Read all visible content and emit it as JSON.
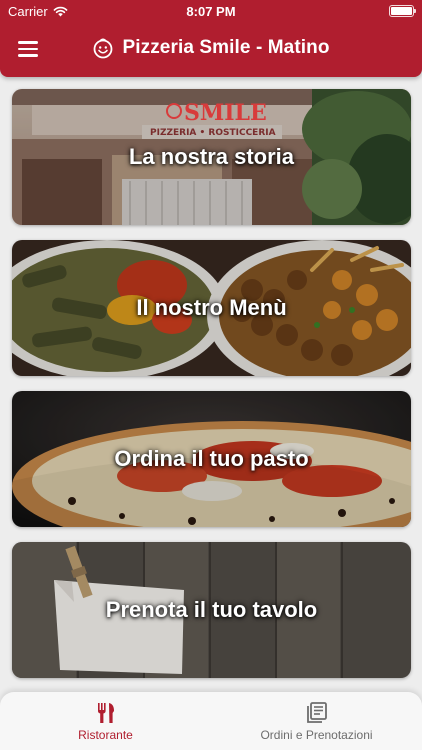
{
  "status_bar": {
    "carrier": "Carrier",
    "time": "8:07 PM"
  },
  "header": {
    "title": "Pizzeria Smile - Matino"
  },
  "cards": [
    {
      "label": "La nostra storia",
      "sign_text": "SMILE",
      "sign_subtext": "PIZZERIA • ROSTICCERIA"
    },
    {
      "label": "Il nostro Menù"
    },
    {
      "label": "Ordina il tuo pasto"
    },
    {
      "label": "Prenota il tuo tavolo"
    }
  ],
  "tab_bar": {
    "tabs": [
      {
        "label": "Ristorante",
        "icon": "fork-knife-icon",
        "active": true
      },
      {
        "label": "Ordini e Prenotazioni",
        "icon": "orders-icon",
        "active": false
      }
    ]
  },
  "colors": {
    "brand": "#b01e2f",
    "inactive": "#6d6d6d",
    "background": "#ededed"
  }
}
